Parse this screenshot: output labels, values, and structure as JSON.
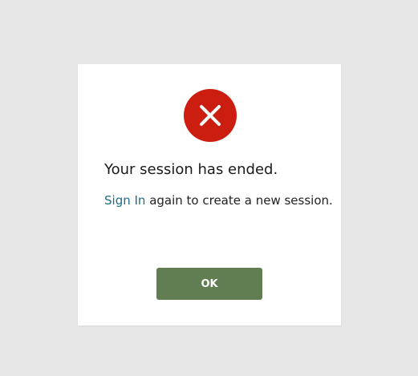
{
  "dialog": {
    "icon": "error-x-icon",
    "icon_color": "#cc1d11",
    "title": "Your session has ended.",
    "message": {
      "link_text": "Sign In",
      "rest_text": " again to create a new session."
    },
    "ok_label": "OK",
    "button_color": "#607e52",
    "link_color": "#1e6c86"
  }
}
